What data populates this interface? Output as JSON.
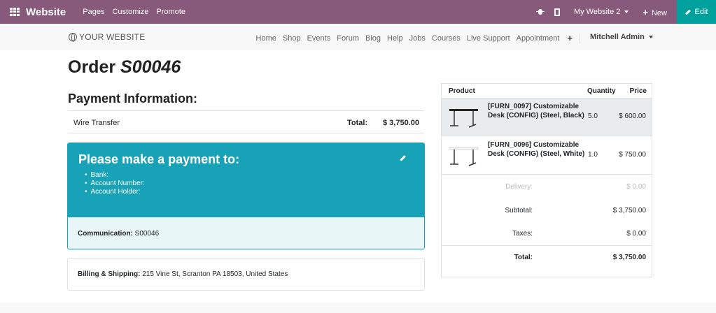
{
  "adminbar": {
    "brand": "Website",
    "menus": [
      "Pages",
      "Customize",
      "Promote"
    ],
    "website_selector": "My Website 2",
    "new_label": "New",
    "edit_label": "Edit"
  },
  "navbar": {
    "logo_text": "YOUR WEBSITE",
    "items": [
      "Home",
      "Shop",
      "Events",
      "Forum",
      "Blog",
      "Help",
      "Jobs",
      "Courses",
      "Live Support",
      "Appointment"
    ],
    "user": "Mitchell Admin"
  },
  "order": {
    "title_prefix": "Order",
    "number": "S00046"
  },
  "payment": {
    "heading": "Payment Information:",
    "method": "Wire Transfer",
    "total_label": "Total:",
    "total_value": "$ 3,750.00"
  },
  "instructions": {
    "heading": "Please make a payment to:",
    "items": [
      "Bank:",
      "Account Number:",
      "Account Holder:"
    ],
    "communication_label": "Communication:",
    "communication_value": "S00046"
  },
  "billing": {
    "label": "Billing & Shipping:",
    "address": "215 Vine St, Scranton PA 18503, United States"
  },
  "summary": {
    "headers": {
      "product": "Product",
      "quantity": "Quantity",
      "price": "Price"
    },
    "lines": [
      {
        "name": "[FURN_0097] Customizable Desk (CONFIG) (Steel, Black)",
        "quantity": "5.0",
        "price": "$ 600.00",
        "desk_top_color": "#222222"
      },
      {
        "name": "[FURN_0096] Customizable Desk (CONFIG) (Steel, White)",
        "quantity": "1.0",
        "price": "$ 750.00",
        "desk_top_color": "#f2f2f2"
      }
    ],
    "delivery_label": "Delivery:",
    "delivery_value": "$ 0.00",
    "subtotal_label": "Subtotal:",
    "subtotal_value": "$ 3,750.00",
    "taxes_label": "Taxes:",
    "taxes_value": "$ 0.00",
    "total_label": "Total:",
    "total_value": "$ 3,750.00"
  },
  "colors": {
    "admin_bar": "#875a7b",
    "edit_button": "#00a09d",
    "info_card": "#17a2b8",
    "info_card_light": "#e8f6f8"
  }
}
